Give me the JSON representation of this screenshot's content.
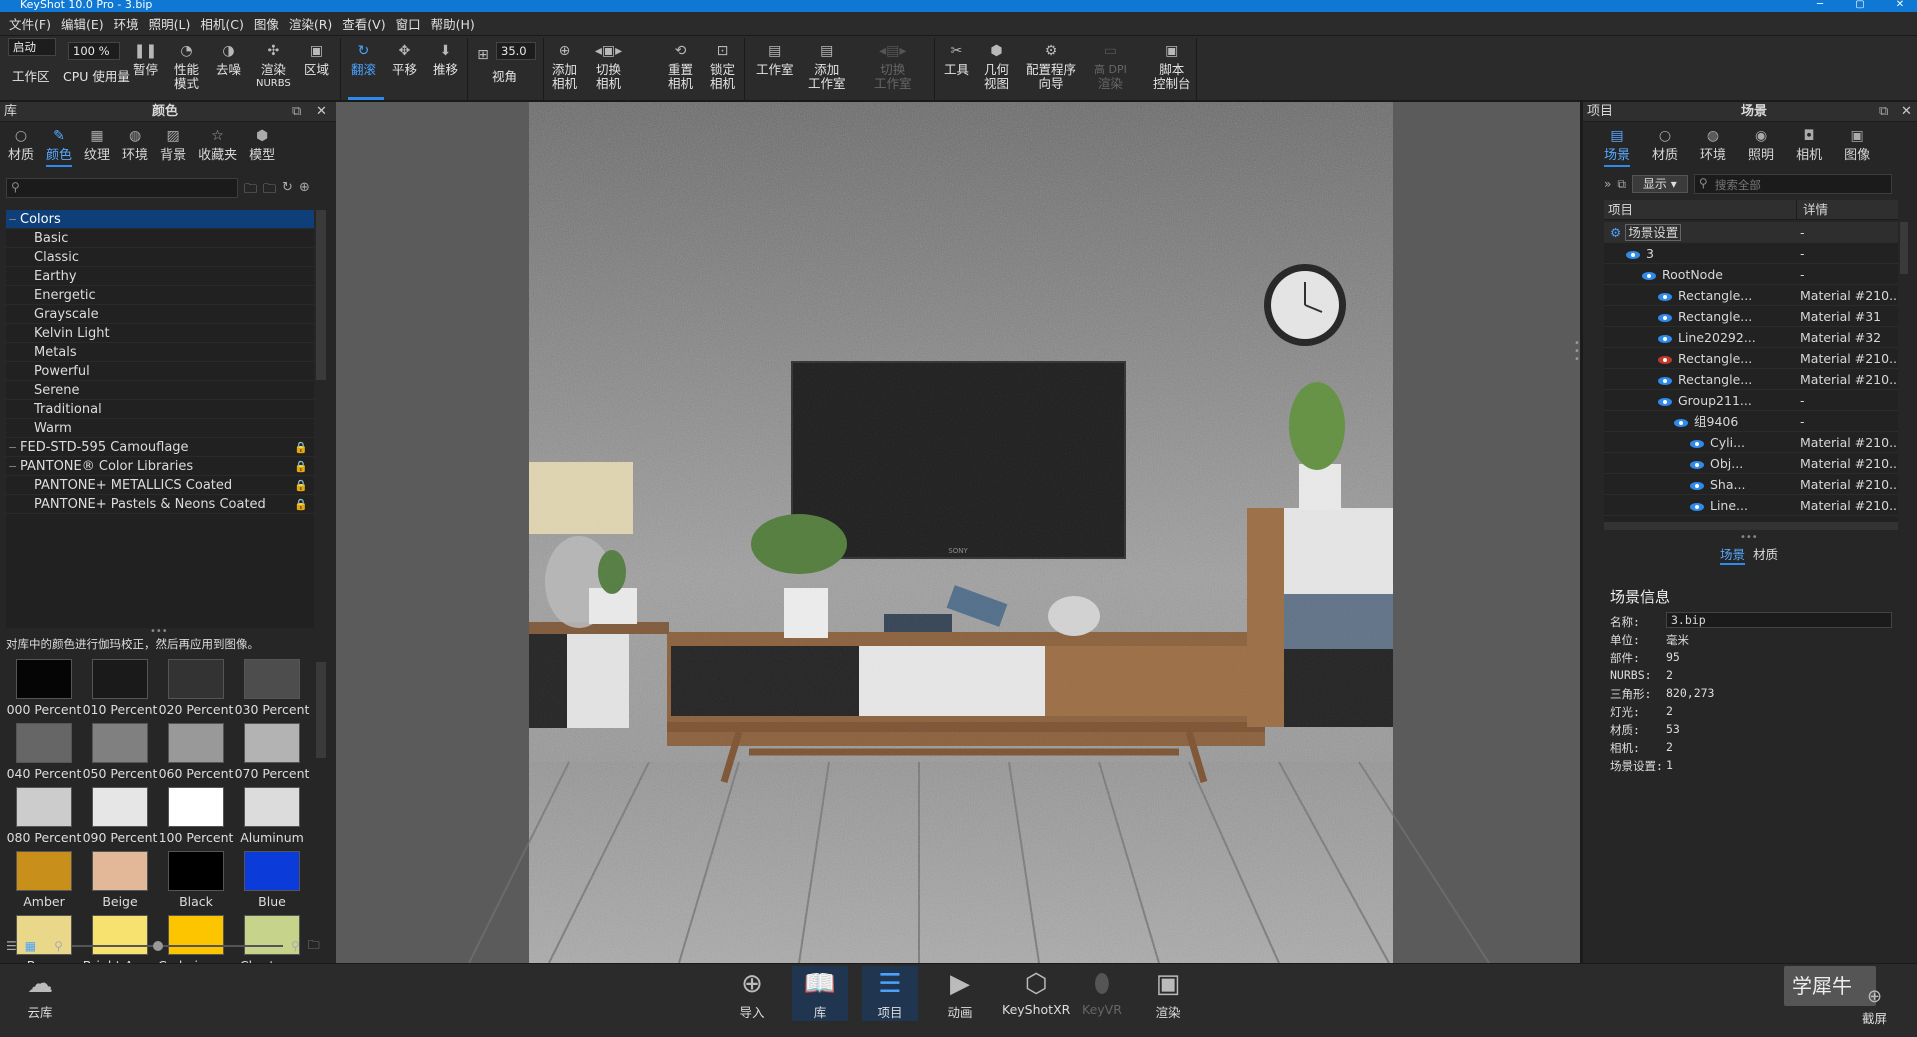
{
  "window": {
    "title": "KeyShot 10.0 Pro  - 3.bip"
  },
  "menu": [
    "文件(F)",
    "编辑(E)",
    "环境",
    "照明(L)",
    "相机(C)",
    "图像",
    "渲染(R)",
    "查看(V)",
    "窗口",
    "帮助(H)"
  ],
  "toolbar": {
    "mode_value": "启动",
    "cpu_value": "100 %",
    "fov_value": "35.0",
    "workspace": "工作区",
    "cpu_usage": "CPU 使用量",
    "pause": "暂停",
    "perf_line1": "性能",
    "perf_line2": "模式",
    "denoise": "去噪",
    "nurbs_line1": "渲染",
    "nurbs_line2": "NURBS",
    "region": "区域",
    "tumble": "翻滚",
    "pan": "平移",
    "dolly": "推移",
    "view_angle": "视角",
    "add_camera_1": "添加",
    "add_camera_2": "相机",
    "switch_camera_1": "切换",
    "switch_camera_2": "相机",
    "reset_camera_1": "重置",
    "reset_camera_2": "相机",
    "lock_camera_1": "锁定",
    "lock_camera_2": "相机",
    "studio": "工作室",
    "add_studio_1": "添加",
    "add_studio_2": "工作室",
    "switch_studio_1": "切换",
    "switch_studio_2": "工作室",
    "tools": "工具",
    "geo_view_1": "几何",
    "geo_view_2": "视图",
    "wizard_1": "配置程序",
    "wizard_2": "向导",
    "hidpi_1": "高 DPI",
    "hidpi_2": "渲染",
    "script_1": "脚本",
    "script_2": "控制台"
  },
  "library": {
    "header_left": "库",
    "header_title": "颜色",
    "tabs": [
      {
        "label": "材质",
        "icon": "material-icon"
      },
      {
        "label": "颜色",
        "icon": "color-icon"
      },
      {
        "label": "纹理",
        "icon": "texture-icon"
      },
      {
        "label": "环境",
        "icon": "environment-icon"
      },
      {
        "label": "背景",
        "icon": "background-icon"
      },
      {
        "label": "收藏夹",
        "icon": "favorites-icon"
      },
      {
        "label": "模型",
        "icon": "model-icon"
      }
    ],
    "tree": [
      {
        "label": "Colors",
        "indent": 0,
        "selected": true,
        "lock": false
      },
      {
        "label": "Basic",
        "indent": 1,
        "selected": false,
        "lock": false
      },
      {
        "label": "Classic",
        "indent": 1,
        "selected": false,
        "lock": false
      },
      {
        "label": "Earthy",
        "indent": 1,
        "selected": false,
        "lock": false
      },
      {
        "label": "Energetic",
        "indent": 1,
        "selected": false,
        "lock": false
      },
      {
        "label": "Grayscale",
        "indent": 1,
        "selected": false,
        "lock": false
      },
      {
        "label": "Kelvin Light",
        "indent": 1,
        "selected": false,
        "lock": false
      },
      {
        "label": "Metals",
        "indent": 1,
        "selected": false,
        "lock": false
      },
      {
        "label": "Powerful",
        "indent": 1,
        "selected": false,
        "lock": false
      },
      {
        "label": "Serene",
        "indent": 1,
        "selected": false,
        "lock": false
      },
      {
        "label": "Traditional",
        "indent": 1,
        "selected": false,
        "lock": false
      },
      {
        "label": "Warm",
        "indent": 1,
        "selected": false,
        "lock": false
      },
      {
        "label": "FED-STD-595 Camouflage",
        "indent": 0,
        "selected": false,
        "lock": true
      },
      {
        "label": "PANTONE® Color Libraries",
        "indent": 0,
        "selected": false,
        "lock": true
      },
      {
        "label": "PANTONE+ METALLICS Coated",
        "indent": 1,
        "selected": false,
        "lock": true
      },
      {
        "label": "PANTONE+ Pastels & Neons Coated",
        "indent": 1,
        "selected": false,
        "lock": true
      }
    ],
    "hint": "对库中的颜色进行伽玛校正，然后再应用到图像。",
    "swatches": [
      {
        "label": "000 Percent",
        "color": "#050505"
      },
      {
        "label": "010 Percent",
        "color": "#1a1a1a"
      },
      {
        "label": "020 Percent",
        "color": "#333333"
      },
      {
        "label": "030 Percent",
        "color": "#4d4d4d"
      },
      {
        "label": "040 Percent",
        "color": "#666666"
      },
      {
        "label": "050 Percent",
        "color": "#808080"
      },
      {
        "label": "060 Percent",
        "color": "#999999"
      },
      {
        "label": "070 Percent",
        "color": "#b3b3b3"
      },
      {
        "label": "080 Percent",
        "color": "#cccccc"
      },
      {
        "label": "090 Percent",
        "color": "#e6e6e6"
      },
      {
        "label": "100 Percent",
        "color": "#ffffff"
      },
      {
        "label": "Aluminum",
        "color": "#dcdcdc"
      },
      {
        "label": "Amber",
        "color": "#c8901a"
      },
      {
        "label": "Beige",
        "color": "#e3b899"
      },
      {
        "label": "Black",
        "color": "#000000"
      },
      {
        "label": "Blue",
        "color": "#0b3bd8"
      },
      {
        "label": "Brass",
        "color": "#ead88a"
      },
      {
        "label": "Bright Am...",
        "color": "#f7e270"
      },
      {
        "label": "Cadmium ...",
        "color": "#fdc400"
      },
      {
        "label": "Charteuse",
        "color": "#c5d48a"
      },
      {
        "label": "",
        "color": "#f4f4f4"
      },
      {
        "label": "",
        "color": "#d7dbe4"
      },
      {
        "label": "",
        "color": "#f6b58b"
      },
      {
        "label": "",
        "color": "#f7f7dc"
      }
    ]
  },
  "scene": {
    "header_left": "项目",
    "header_title": "场景",
    "tabs": [
      {
        "label": "场景",
        "icon": "scene-icon"
      },
      {
        "label": "材质",
        "icon": "material-icon"
      },
      {
        "label": "环境",
        "icon": "environment-icon"
      },
      {
        "label": "照明",
        "icon": "lighting-icon"
      },
      {
        "label": "相机",
        "icon": "camera-icon"
      },
      {
        "label": "图像",
        "icon": "image-icon"
      }
    ],
    "show_label": "显示",
    "search_placeholder": "搜索全部",
    "col_item": "项目",
    "col_detail": "详情",
    "rows": [
      {
        "name": "场景设置",
        "detail": "-",
        "indent": 0,
        "eye": "none",
        "selected": true
      },
      {
        "name": "3",
        "detail": "-",
        "indent": 1,
        "eye": "blue",
        "selected": false
      },
      {
        "name": "RootNode",
        "detail": "-",
        "indent": 2,
        "eye": "blue",
        "selected": false
      },
      {
        "name": "Rectangle...",
        "detail": "Material #210...",
        "indent": 3,
        "eye": "blue",
        "selected": false
      },
      {
        "name": "Rectangle...",
        "detail": "Material #31",
        "indent": 3,
        "eye": "blue",
        "selected": false
      },
      {
        "name": "Line20292...",
        "detail": "Material #32",
        "indent": 3,
        "eye": "blue",
        "selected": false
      },
      {
        "name": "Rectangle...",
        "detail": "Material #210...",
        "indent": 3,
        "eye": "red",
        "selected": false
      },
      {
        "name": "Rectangle...",
        "detail": "Material #210...",
        "indent": 3,
        "eye": "blue",
        "selected": false
      },
      {
        "name": "Group211...",
        "detail": "-",
        "indent": 3,
        "eye": "blue",
        "selected": false
      },
      {
        "name": "组9406",
        "detail": "-",
        "indent": 4,
        "eye": "blue",
        "selected": false
      },
      {
        "name": "Cyli...",
        "detail": "Material #210...",
        "indent": 5,
        "eye": "blue",
        "selected": false
      },
      {
        "name": "Obj...",
        "detail": "Material #210...",
        "indent": 5,
        "eye": "blue",
        "selected": false
      },
      {
        "name": "Sha...",
        "detail": "Material #210...",
        "indent": 5,
        "eye": "blue",
        "selected": false
      },
      {
        "name": "Line...",
        "detail": "Material #210...",
        "indent": 5,
        "eye": "blue",
        "selected": false
      }
    ],
    "subtab_scene": "场景",
    "subtab_material": "材质",
    "info_title": "场景信息",
    "info": {
      "name_label": "名称:",
      "name_value": "3.bip",
      "unit_label": "单位:",
      "unit_value": "毫米",
      "parts_label": "部件:",
      "parts_value": "95",
      "nurbs_label": "NURBS:",
      "nurbs_value": "2",
      "tri_label": "三角形:",
      "tri_value": "820,273",
      "lights_label": "灯光:",
      "lights_value": "2",
      "mat_label": "材质:",
      "mat_value": "53",
      "cam_label": "相机:",
      "cam_value": "2",
      "ss_label": "场景设置:",
      "ss_value": "1"
    }
  },
  "viewport": {
    "tv_brand": "SONY"
  },
  "bottom": {
    "cloud": "云库",
    "import": "导入",
    "library": "库",
    "project": "项目",
    "animation": "动画",
    "keyshotxr": "KeyShotXR",
    "keyvr": "KeyVR",
    "render": "渲染",
    "screenshot": "截屏",
    "watermark": "学犀牛"
  }
}
